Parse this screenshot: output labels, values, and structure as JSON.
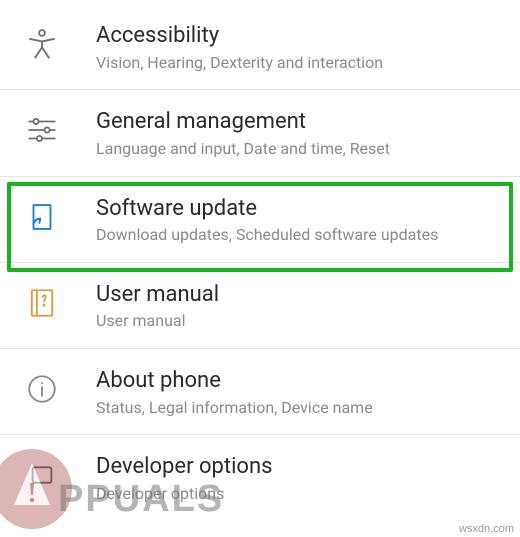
{
  "settings": [
    {
      "title": "Accessibility",
      "sub": "Vision, Hearing, Dexterity and interaction",
      "icon": "accessibility-icon",
      "color": "#6f6f6f"
    },
    {
      "title": "General management",
      "sub": "Language and input, Date and time, Reset",
      "icon": "sliders-icon",
      "color": "#6f6f6f"
    },
    {
      "title": "Software update",
      "sub": "Download updates, Scheduled software updates",
      "icon": "update-icon",
      "color": "#1b7fde"
    },
    {
      "title": "User manual",
      "sub": "User manual",
      "icon": "manual-icon",
      "color": "#e09a3e"
    },
    {
      "title": "About phone",
      "sub": "Status, Legal information, Device name",
      "icon": "info-icon",
      "color": "#8a8a8a"
    },
    {
      "title": "Developer options",
      "sub": "Developer options",
      "icon": "developer-icon",
      "color": "#6f6f6f"
    }
  ],
  "watermark": {
    "text": "PPUALS",
    "credit": "wsxdn.com"
  }
}
